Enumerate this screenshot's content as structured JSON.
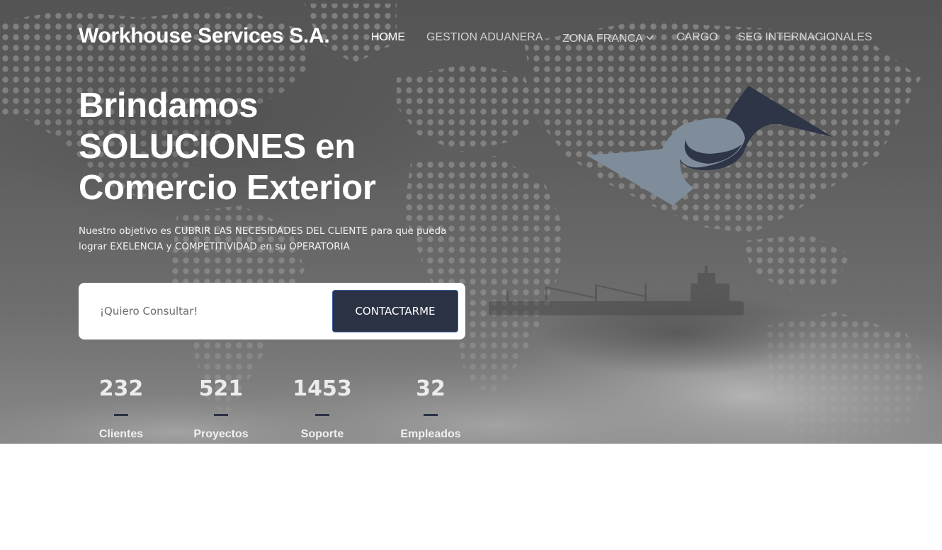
{
  "nav": {
    "brand": "Workhouse Services S.A.",
    "links": [
      {
        "label": "HOME",
        "active": true
      },
      {
        "label": "GESTION ADUANERA",
        "active": false
      },
      {
        "label": "ZONA FRANCA",
        "active": false,
        "dropdown": true
      },
      {
        "label": "CARGO",
        "active": false
      },
      {
        "label": "SEG INTERNACIONALES",
        "active": false
      }
    ]
  },
  "hero": {
    "headline": [
      "Brindamos",
      "SOLUCIONES en",
      "Comercio Exterior"
    ],
    "subtitle": [
      "Nuestro objetivo es CUBRIR LAS NECESIDADES DEL CLIENTE para que pueda",
      "lograr EXELENCIA y COMPETITIVIDAD en su OPERATORIA"
    ],
    "logo_icon": "company-swoosh-logo-icon",
    "background": "world-dot-map-with-cargo-ship-in-fog"
  },
  "contact": {
    "placeholder": "¡Quiero Consultar!",
    "button_label": "CONTACTARME"
  },
  "stats": [
    {
      "value": "232",
      "label": "Clientes"
    },
    {
      "value": "521",
      "label": "Proyectos"
    },
    {
      "value": "1453",
      "label": "Soporte"
    },
    {
      "value": "32",
      "label": "Empleados"
    }
  ],
  "colors": {
    "accent_dark": "#2b3244",
    "logo_dark": "#2d3547",
    "logo_light": "#7f8d9b",
    "button_border": "#3d63a8"
  }
}
